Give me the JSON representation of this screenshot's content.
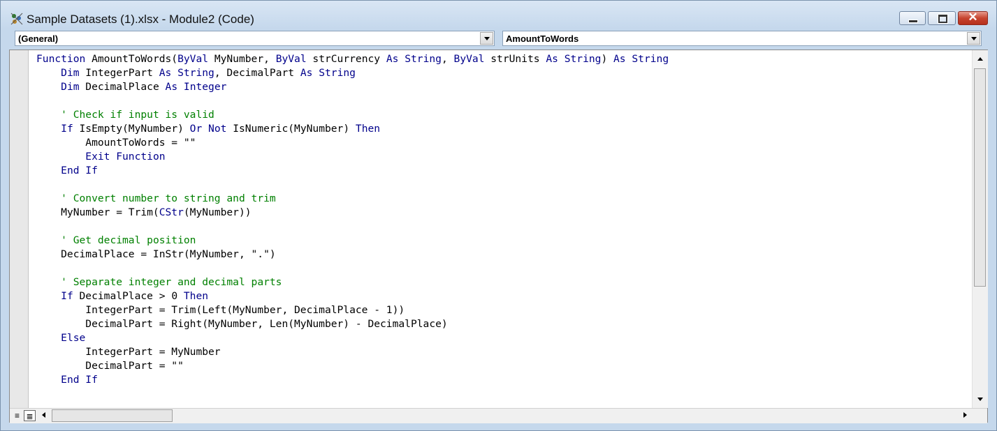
{
  "window": {
    "title": "Sample Datasets (1).xlsx - Module2 (Code)",
    "close_glyph": "✕"
  },
  "object_combo": {
    "value": "(General)"
  },
  "procedure_combo": {
    "value": "AmountToWords"
  },
  "code": {
    "line1": {
      "kw1": "Function",
      "t1": " AmountToWords(",
      "kw2": "ByVal",
      "t2": " MyNumber, ",
      "kw3": "ByVal",
      "t3": " strCurrency ",
      "kw4": "As",
      "t4": " ",
      "kw5": "String",
      "t5": ", ",
      "kw6": "ByVal",
      "t6": " strUnits ",
      "kw7": "As",
      "t7": " ",
      "kw8": "String",
      "t8": ") ",
      "kw9": "As",
      "t9": " ",
      "kw10": "String"
    },
    "line2": {
      "ind": "    ",
      "kw1": "Dim",
      "t1": " IntegerPart ",
      "kw2": "As",
      "t2": " ",
      "kw3": "String",
      "t3": ", DecimalPart ",
      "kw4": "As",
      "t4": " ",
      "kw5": "String"
    },
    "line3": {
      "ind": "    ",
      "kw1": "Dim",
      "t1": " DecimalPlace ",
      "kw2": "As",
      "t2": " ",
      "kw3": "Integer"
    },
    "line5": {
      "ind": "    ",
      "comment": "' Check if input is valid"
    },
    "line6": {
      "ind": "    ",
      "kw1": "If",
      "t1": " IsEmpty(MyNumber) ",
      "kw2": "Or",
      "t2": " ",
      "kw3": "Not",
      "t3": " IsNumeric(MyNumber) ",
      "kw4": "Then"
    },
    "line7": {
      "text": "        AmountToWords = \"\""
    },
    "line8": {
      "ind": "        ",
      "kw1": "Exit Function"
    },
    "line9": {
      "ind": "    ",
      "kw1": "End If"
    },
    "line11": {
      "ind": "    ",
      "comment": "' Convert number to string and trim"
    },
    "line12": {
      "t1": "    MyNumber = Trim(",
      "kw1": "CStr",
      "t2": "(MyNumber))"
    },
    "line14": {
      "ind": "    ",
      "comment": "' Get decimal position"
    },
    "line15": {
      "text": "    DecimalPlace = InStr(MyNumber, \".\")"
    },
    "line17": {
      "ind": "    ",
      "comment": "' Separate integer and decimal parts"
    },
    "line18": {
      "ind": "    ",
      "kw1": "If",
      "t1": " DecimalPlace > 0 ",
      "kw2": "Then"
    },
    "line19": {
      "text": "        IntegerPart = Trim(Left(MyNumber, DecimalPlace - 1))"
    },
    "line20": {
      "text": "        DecimalPart = Right(MyNumber, Len(MyNumber) - DecimalPlace)"
    },
    "line21": {
      "ind": "    ",
      "kw1": "Else"
    },
    "line22": {
      "text": "        IntegerPart = MyNumber"
    },
    "line23": {
      "text": "        DecimalPart = \"\""
    },
    "line24": {
      "ind": "    ",
      "kw1": "End If"
    }
  },
  "bottom": {
    "procedure_view_glyph": "≡",
    "full_module_view_glyph": "≣"
  },
  "colors": {
    "keyword": "#00008b",
    "comment": "#008000",
    "text": "#000000",
    "close_button": "#c7442f"
  },
  "icons": [
    "vba-module-icon",
    "minimize-icon",
    "maximize-icon",
    "close-icon",
    "dropdown-arrow-icon",
    "scroll-up-icon",
    "scroll-down-icon",
    "scroll-left-icon",
    "scroll-right-icon"
  ]
}
